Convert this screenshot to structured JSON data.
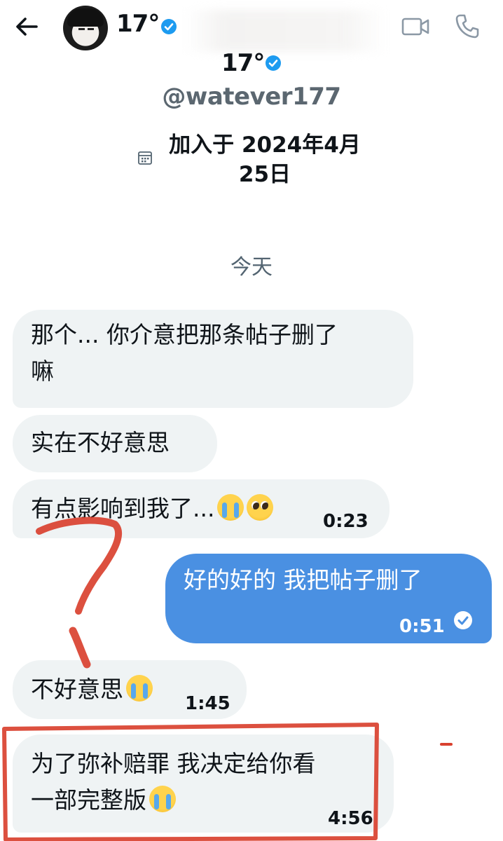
{
  "header": {
    "back_icon": "arrow-left-icon",
    "name": "17°",
    "verified_icon": "verified-badge-icon",
    "video_icon": "video-call-icon",
    "phone_icon": "phone-call-icon"
  },
  "profile": {
    "name": "17°",
    "handle": "@watever177",
    "joined_line1": "加入于 2024年4月",
    "joined_line2": "25日",
    "calendar_icon": "calendar-icon"
  },
  "day_separator": "今天",
  "messages": [
    {
      "direction": "incoming",
      "line1": "那个... 你介意把那条帖子删了",
      "line2": "嘛"
    },
    {
      "direction": "incoming",
      "text": "实在不好意思"
    },
    {
      "direction": "incoming",
      "text": "有点影响到我了...",
      "emojis": [
        "crying-face",
        "pleading-face"
      ],
      "time": "0:23"
    },
    {
      "direction": "outgoing",
      "text": "好的好的 我把帖子删了",
      "time": "0:51",
      "status_icon": "read-check-icon"
    },
    {
      "direction": "incoming",
      "text": "不好意思",
      "emojis": [
        "crying-face"
      ],
      "time": "1:45"
    },
    {
      "direction": "incoming",
      "line1": "为了弥补赔罪 我决定给你看",
      "line2": "一部完整版",
      "emojis": [
        "crying-face"
      ],
      "time": "4:56"
    }
  ],
  "colors": {
    "incoming_bubble": "#eff3f4",
    "outgoing_bubble": "#4a90e2",
    "verified": "#1d9bf0",
    "annotation_red": "#d9412f"
  }
}
